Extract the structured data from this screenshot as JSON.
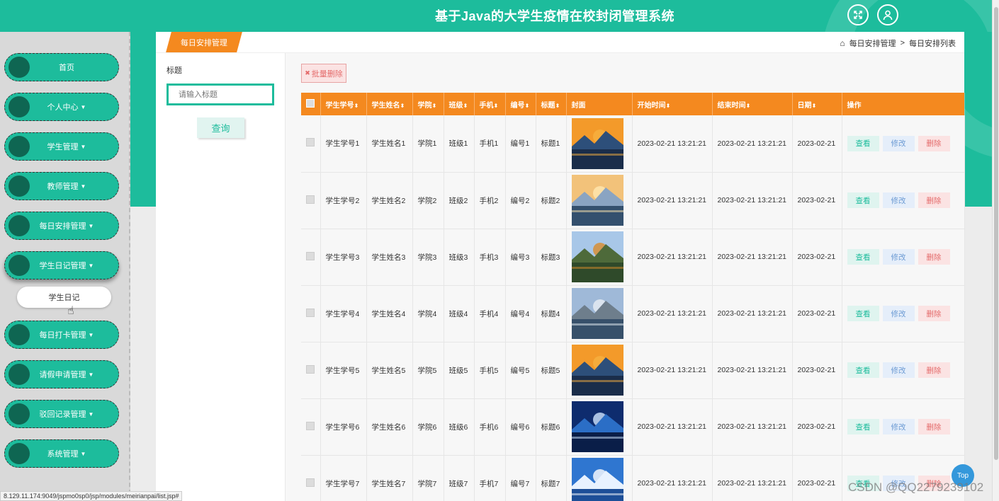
{
  "header": {
    "title": "基于Java的大学生疫情在校封闭管理系统"
  },
  "sidebar": {
    "items": [
      {
        "label": "首页",
        "has_caret": false
      },
      {
        "label": "个人中心",
        "has_caret": true
      },
      {
        "label": "学生管理",
        "has_caret": true
      },
      {
        "label": "教师管理",
        "has_caret": true
      },
      {
        "label": "每日安排管理",
        "has_caret": true
      },
      {
        "label": "学生日记管理",
        "has_caret": true
      },
      {
        "label": "每日打卡管理",
        "has_caret": true
      },
      {
        "label": "请假申请管理",
        "has_caret": true
      },
      {
        "label": "驳回记录管理",
        "has_caret": true
      },
      {
        "label": "系统管理",
        "has_caret": true
      }
    ],
    "active_index": 5,
    "submenu": {
      "label": "学生日记"
    }
  },
  "panel": {
    "tab": "每日安排管理",
    "breadcrumb": {
      "level1": "每日安排管理",
      "separator": ">",
      "level2": "每日安排列表"
    }
  },
  "search": {
    "label": "标题",
    "placeholder": "请输入标题",
    "button": "查询"
  },
  "actions": {
    "batch_delete": "批量删除",
    "batch_delete_icon": "✖"
  },
  "table": {
    "columns": [
      "学生学号",
      "学生姓名",
      "学院",
      "班级",
      "手机",
      "编号",
      "标题",
      "封面",
      "开始时间",
      "结束时间",
      "日期",
      "操作"
    ],
    "sortable": [
      true,
      true,
      true,
      true,
      true,
      true,
      true,
      false,
      true,
      true,
      true,
      false
    ],
    "rows": [
      {
        "student_no": "学生学号1",
        "student_name": "学生姓名1",
        "college": "学院1",
        "class": "班级1",
        "phone": "手机1",
        "code": "编号1",
        "title": "标题1",
        "cover": "sunset-lake",
        "start": "2023-02-21 13:21:21",
        "end": "2023-02-21 13:21:21",
        "date": "2023-02-21"
      },
      {
        "student_no": "学生学号2",
        "student_name": "学生姓名2",
        "college": "学院2",
        "class": "班级2",
        "phone": "手机2",
        "code": "编号2",
        "title": "标题2",
        "cover": "sunrise-boat",
        "start": "2023-02-21 13:21:21",
        "end": "2023-02-21 13:21:21",
        "date": "2023-02-21"
      },
      {
        "student_no": "学生学号3",
        "student_name": "学生姓名3",
        "college": "学院3",
        "class": "班级3",
        "phone": "手机3",
        "code": "编号3",
        "title": "标题3",
        "cover": "autumn-mountain-lake",
        "start": "2023-02-21 13:21:21",
        "end": "2023-02-21 13:21:21",
        "date": "2023-02-21"
      },
      {
        "student_no": "学生学号4",
        "student_name": "学生姓名4",
        "college": "学院4",
        "class": "班级4",
        "phone": "手机4",
        "code": "编号4",
        "title": "标题4",
        "cover": "alpine-lake",
        "start": "2023-02-21 13:21:21",
        "end": "2023-02-21 13:21:21",
        "date": "2023-02-21"
      },
      {
        "student_no": "学生学号5",
        "student_name": "学生姓名5",
        "college": "学院5",
        "class": "班级5",
        "phone": "手机5",
        "code": "编号5",
        "title": "标题5",
        "cover": "sunset-lake",
        "start": "2023-02-21 13:21:21",
        "end": "2023-02-21 13:21:21",
        "date": "2023-02-21"
      },
      {
        "student_no": "学生学号6",
        "student_name": "学生姓名6",
        "college": "学院6",
        "class": "班级6",
        "phone": "手机6",
        "code": "编号6",
        "title": "标题6",
        "cover": "blue-planet",
        "start": "2023-02-21 13:21:21",
        "end": "2023-02-21 13:21:21",
        "date": "2023-02-21"
      },
      {
        "student_no": "学生学号7",
        "student_name": "学生姓名7",
        "college": "学院7",
        "class": "班级7",
        "phone": "手机7",
        "code": "编号7",
        "title": "标题7",
        "cover": "santorini",
        "start": "2023-02-21 13:21:21",
        "end": "2023-02-21 13:21:21",
        "date": "2023-02-21"
      }
    ],
    "row_actions": {
      "view": "查看",
      "edit": "修改",
      "delete": "删除"
    }
  },
  "statusbar": {
    "url": "8.129.11.174:9049/jspmo0sp0/jsp/modules/meirianpai/list.jsp#"
  },
  "top_button": "Top",
  "watermark": "CSDN @QQ2279239102",
  "colors": {
    "primary": "#1dbc9c",
    "accent": "#f4891f",
    "danger": "#e46a6a",
    "info": "#6c9bd4"
  }
}
